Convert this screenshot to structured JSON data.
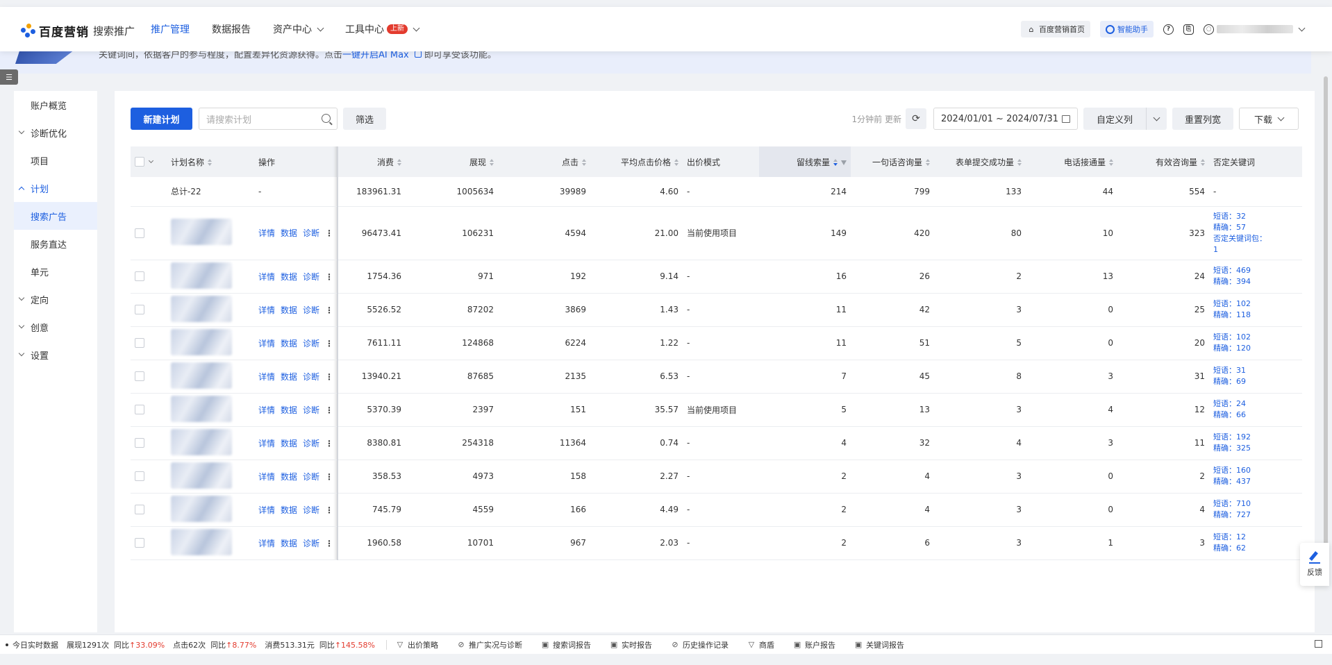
{
  "header": {
    "logo_name": "百度营销",
    "logo_sub": "搜索推广",
    "nav": [
      {
        "label": "推广管理",
        "active": true,
        "dropdown": false
      },
      {
        "label": "数据报告",
        "active": false,
        "dropdown": false
      },
      {
        "label": "资产中心",
        "active": false,
        "dropdown": true
      },
      {
        "label": "工具中心",
        "active": false,
        "dropdown": true,
        "badge": "上新"
      }
    ],
    "home_link": "百度营销首页",
    "ai_assistant": "智能助手",
    "help_icon": "?",
    "accent": "#1d5fe0"
  },
  "banner": {
    "text_pre": "关键词间，依据客户的参与程度，配置差异化资源获得。点击",
    "link": "一键开启AI Max",
    "text_post": "即可享受该功能。"
  },
  "sidebar": {
    "items": [
      {
        "label": "账户概览",
        "type": "item"
      },
      {
        "label": "诊断优化",
        "type": "group"
      },
      {
        "label": "项目",
        "type": "item"
      },
      {
        "label": "计划",
        "type": "group-open"
      },
      {
        "label": "搜索广告",
        "type": "item",
        "active": true
      },
      {
        "label": "服务直达",
        "type": "item"
      },
      {
        "label": "单元",
        "type": "item"
      },
      {
        "label": "定向",
        "type": "group"
      },
      {
        "label": "创意",
        "type": "group"
      },
      {
        "label": "设置",
        "type": "group"
      }
    ]
  },
  "toolbar": {
    "new_plan": "新建计划",
    "search_placeholder": "请搜索计划",
    "filter": "筛选",
    "update_text": "1分钟前 更新",
    "date_range": "2024/01/01 ~ 2024/07/31",
    "custom_columns": "自定义列",
    "reset_width": "重置列宽",
    "download": "下载"
  },
  "table": {
    "columns": [
      "计划名称",
      "操作",
      "消费",
      "展现",
      "点击",
      "平均点击价格",
      "出价模式",
      "留线索量",
      "一句话咨询量",
      "表单提交成功量",
      "电话接通量",
      "有效咨询量",
      "否定关键词"
    ],
    "ops": [
      "详情",
      "数据",
      "诊断"
    ],
    "total": {
      "name": "总计-22",
      "op": "-",
      "cost": "183961.31",
      "impr": "1005634",
      "click": "39989",
      "cpc": "4.60",
      "bid": "-",
      "leads": "214",
      "chat": "799",
      "form": "133",
      "phone": "44",
      "valid": "554",
      "neg": "-"
    },
    "rows": [
      {
        "name_hint": "…户…例",
        "cost": "96473.41",
        "impr": "106231",
        "click": "4594",
        "cpc": "21.00",
        "bid": "当前使用项目",
        "leads": "149",
        "chat": "420",
        "form": "80",
        "phone": "10",
        "valid": "323",
        "neg": [
          "短语：32",
          "精确：57",
          "否定关键词包：",
          "1"
        ]
      },
      {
        "name_hint": "…前",
        "cost": "1754.36",
        "impr": "971",
        "click": "192",
        "cpc": "9.14",
        "bid": "-",
        "leads": "16",
        "chat": "26",
        "form": "2",
        "phone": "13",
        "valid": "24",
        "neg": [
          "短语：469",
          "精确：394"
        ]
      },
      {
        "name_hint": "…",
        "cost": "5526.52",
        "impr": "87202",
        "click": "3869",
        "cpc": "1.43",
        "bid": "-",
        "leads": "11",
        "chat": "42",
        "form": "3",
        "phone": "0",
        "valid": "25",
        "neg": [
          "短语：102",
          "精确：118"
        ]
      },
      {
        "name_hint": "…",
        "cost": "7611.11",
        "impr": "124868",
        "click": "6224",
        "cpc": "1.22",
        "bid": "-",
        "leads": "11",
        "chat": "51",
        "form": "5",
        "phone": "0",
        "valid": "20",
        "neg": [
          "短语：102",
          "精确：120"
        ]
      },
      {
        "name_hint": "…",
        "cost": "13940.21",
        "impr": "87685",
        "click": "2135",
        "cpc": "6.53",
        "bid": "-",
        "leads": "7",
        "chat": "45",
        "form": "8",
        "phone": "3",
        "valid": "31",
        "neg": [
          "短语：31",
          "精确：69"
        ]
      },
      {
        "name_hint": "…",
        "cost": "5370.39",
        "impr": "2397",
        "click": "151",
        "cpc": "35.57",
        "bid": "当前使用项目",
        "leads": "5",
        "chat": "13",
        "form": "3",
        "phone": "4",
        "valid": "12",
        "neg": [
          "短语：24",
          "精确：66"
        ]
      },
      {
        "name_hint": "…格",
        "cost": "8380.81",
        "impr": "254318",
        "click": "11364",
        "cpc": "0.74",
        "bid": "-",
        "leads": "4",
        "chat": "32",
        "form": "4",
        "phone": "3",
        "valid": "11",
        "neg": [
          "短语：192",
          "精确：325"
        ]
      },
      {
        "name_hint": "…育",
        "cost": "358.53",
        "impr": "4973",
        "click": "158",
        "cpc": "2.27",
        "bid": "-",
        "leads": "2",
        "chat": "4",
        "form": "3",
        "phone": "0",
        "valid": "2",
        "neg": [
          "短语：160",
          "精确：437"
        ]
      },
      {
        "name_hint": "…",
        "cost": "745.79",
        "impr": "4559",
        "click": "166",
        "cpc": "4.49",
        "bid": "-",
        "leads": "2",
        "chat": "4",
        "form": "3",
        "phone": "0",
        "valid": "4",
        "neg": [
          "短语：710",
          "精确：727"
        ]
      },
      {
        "name_hint": "…",
        "cost": "1960.58",
        "impr": "10701",
        "click": "967",
        "cpc": "2.03",
        "bid": "-",
        "leads": "2",
        "chat": "6",
        "form": "3",
        "phone": "1",
        "valid": "3",
        "neg": [
          "短语：12",
          "精确：62"
        ]
      }
    ]
  },
  "feedback": "反馈",
  "bottombar": {
    "realtime": "今日实时数据",
    "impr": "展现1291次",
    "impr_cmp_label": "同比",
    "impr_cmp": "↑33.09%",
    "click": "点击62次",
    "click_cmp_label": "同比",
    "click_cmp": "↑8.77%",
    "cost": "消费513.31元",
    "cost_cmp_label": "同比",
    "cost_cmp": "↑145.58%",
    "links": [
      {
        "label": "出价策略",
        "icon": "funnel-icon"
      },
      {
        "label": "推广实况与诊断",
        "icon": "compass-icon"
      },
      {
        "label": "搜索词报告",
        "icon": "report-icon"
      },
      {
        "label": "实时报告",
        "icon": "clock-report-icon"
      },
      {
        "label": "历史操作记录",
        "icon": "history-icon"
      },
      {
        "label": "商盾",
        "icon": "shield-icon"
      },
      {
        "label": "账户报告",
        "icon": "account-report-icon"
      },
      {
        "label": "关键词报告",
        "icon": "keyword-report-icon"
      }
    ]
  }
}
